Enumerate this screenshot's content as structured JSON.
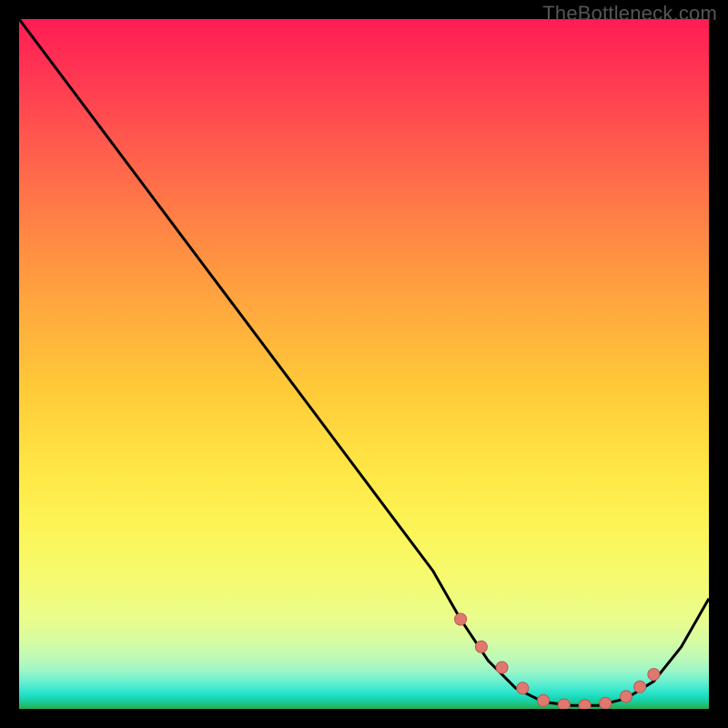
{
  "watermark": "TheBottleneck.com",
  "colors": {
    "frame": "#000000",
    "curve": "#000000",
    "marker_fill": "#e0786f",
    "marker_stroke": "#b85a52"
  },
  "chart_data": {
    "type": "line",
    "title": "",
    "xlabel": "",
    "ylabel": "",
    "xlim": [
      0,
      100
    ],
    "ylim": [
      0,
      100
    ],
    "grid": false,
    "legend": false,
    "series": [
      {
        "name": "bottleneck-curve",
        "x": [
          0,
          6,
          12,
          18,
          24,
          30,
          36,
          42,
          48,
          54,
          60,
          64,
          68,
          72,
          76,
          80,
          84,
          88,
          92,
          96,
          100
        ],
        "y": [
          100,
          92,
          84,
          76,
          68,
          60,
          52,
          44,
          36,
          28,
          20,
          13,
          7,
          3,
          1,
          0.5,
          0.5,
          1.5,
          4,
          9,
          16
        ]
      }
    ],
    "markers": {
      "name": "highlight-range",
      "x": [
        64,
        67,
        70,
        73,
        76,
        79,
        82,
        85,
        88,
        90,
        92
      ],
      "y": [
        13,
        9,
        6,
        3,
        1.2,
        0.6,
        0.5,
        0.8,
        1.8,
        3.2,
        5
      ]
    },
    "gradient_stops": [
      {
        "pos": 0.0,
        "color": "#ff1c53"
      },
      {
        "pos": 0.3,
        "color": "#ff8445"
      },
      {
        "pos": 0.55,
        "color": "#ffcb38"
      },
      {
        "pos": 0.78,
        "color": "#f7fa68"
      },
      {
        "pos": 0.92,
        "color": "#c4fbb2"
      },
      {
        "pos": 1.0,
        "color": "#29ad52"
      }
    ]
  }
}
